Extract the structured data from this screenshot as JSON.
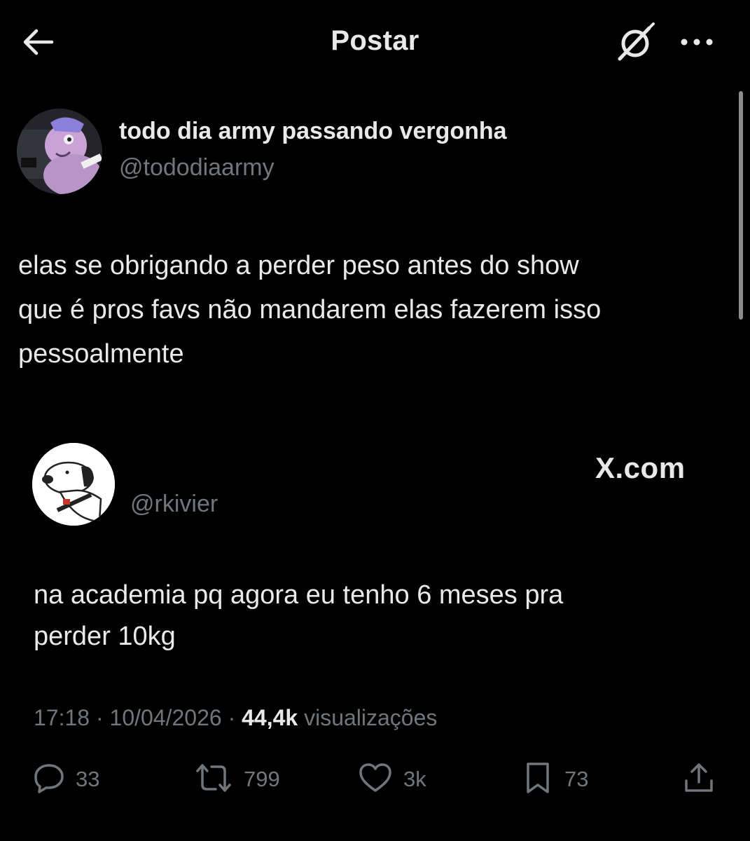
{
  "header": {
    "title": "Postar"
  },
  "post": {
    "author_name": "todo dia army passando vergonha",
    "author_handle": "@tododiaarmy",
    "text_lines": [
      "elas se obrigando a perder peso antes do show",
      "que é pros favs não mandarem elas fazerem isso",
      "pessoalmente"
    ],
    "embedded": {
      "handle": "@rkivier",
      "brand": "X.com",
      "text_lines": [
        "na academia pq agora eu tenho 6 meses pra",
        "perder 10kg"
      ]
    },
    "meta": {
      "time": "17:18",
      "sep1": " · ",
      "date": "10/04/2026",
      "sep2": " · ",
      "views_count": "44,4k",
      "views_label": " visualizações"
    },
    "actions": {
      "replies": "33",
      "reposts": "799",
      "likes": "3k",
      "bookmarks": "73"
    }
  },
  "icons": {
    "back": "arrow-left-icon",
    "grok": "grok-icon",
    "more": "more-icon",
    "reply": "comment-icon",
    "repost": "repost-icon",
    "like": "heart-icon",
    "bookmark": "bookmark-icon",
    "share": "share-icon"
  },
  "colors": {
    "background": "#000000",
    "text_primary": "#e7e9ea",
    "text_secondary": "#71767b"
  }
}
